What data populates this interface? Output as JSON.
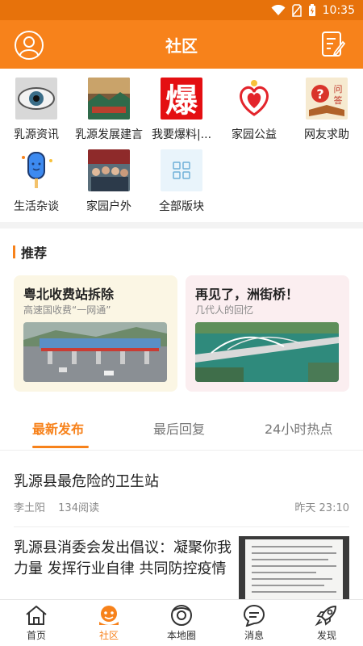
{
  "status_bar": {
    "time": "10:35"
  },
  "app_bar": {
    "title": "社区"
  },
  "forums": [
    {
      "label": "乳源资讯",
      "icon": "eye-photo"
    },
    {
      "label": "乳源发展建言",
      "icon": "landscape-photo"
    },
    {
      "label": "我要爆料|...",
      "icon": "bao-character"
    },
    {
      "label": "家园公益",
      "icon": "heart-hands"
    },
    {
      "label": "网友求助",
      "icon": "question-book"
    },
    {
      "label": "生活杂谈",
      "icon": "popsicle"
    },
    {
      "label": "家园户外",
      "icon": "group-photo"
    },
    {
      "label": "全部版块",
      "icon": "grid-icon"
    }
  ],
  "recommend": {
    "header": "推荐",
    "cards": [
      {
        "title": "粤北收费站拆除",
        "subtitle": "高速国收费“一网通”"
      },
      {
        "title": "再见了，洲街桥！",
        "subtitle": "几代人的回忆"
      }
    ]
  },
  "tabs": [
    "最新发布",
    "最后回复",
    "24小时热点"
  ],
  "posts": [
    {
      "title": "乳源县最危险的卫生站",
      "author": "李土阳",
      "reads": "134阅读",
      "time": "昨天 23:10"
    },
    {
      "title": "乳源县消委会发出倡议：凝聚你我力量 发挥行业自律 共同防控疫情"
    }
  ],
  "bottom_nav": [
    {
      "label": "首页",
      "icon": "home-icon",
      "active": false
    },
    {
      "label": "社区",
      "icon": "community-icon",
      "active": true
    },
    {
      "label": "本地圈",
      "icon": "local-circle-icon",
      "active": false
    },
    {
      "label": "消息",
      "icon": "message-icon",
      "active": false
    },
    {
      "label": "发现",
      "icon": "rocket-icon",
      "active": false
    }
  ],
  "colors": {
    "primary": "#f7821b",
    "statusbar": "#e7720b",
    "card1_bg": "#fbf6e4",
    "card2_bg": "#fbeef0"
  }
}
